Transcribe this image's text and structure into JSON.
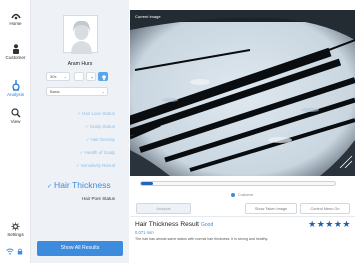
{
  "nav": {
    "items": [
      {
        "label": "Home",
        "icon": "home-icon"
      },
      {
        "label": "Customer",
        "icon": "person-icon"
      },
      {
        "label": "Analysis",
        "icon": "analysis-icon",
        "active": true
      },
      {
        "label": "View",
        "icon": "search-icon"
      }
    ],
    "settings_label": "Settings"
  },
  "profile": {
    "name": "Aram Hurs",
    "zoom_select": "30x",
    "mode_select": "Basic"
  },
  "checklist": [
    {
      "label": "Hair Loss Status"
    },
    {
      "label": "Scalp Status"
    },
    {
      "label": "Hair Density"
    },
    {
      "label": "Health of Scalp"
    },
    {
      "label": "Sensitivity Result"
    }
  ],
  "selected_item": "Hair Thickness",
  "sub_item": "Hair Pore Status",
  "show_all_label": "Show All Results",
  "image": {
    "label": "Current Image"
  },
  "slider": {
    "progress": 0.06
  },
  "radio_label": "Customer",
  "buttons": {
    "analysis": "Analysis",
    "show_taken": "Show Taken Image",
    "control_menu": "Control Menu On"
  },
  "result": {
    "title": "Hair Thickness Result",
    "status": "Good",
    "value": "0.071 mm",
    "description": "The hair has almost same status with normal hair thickness. It is strong and healthy.",
    "stars": 5
  },
  "colors": {
    "accent": "#3d8bdc",
    "star": "#1f5fa8",
    "panel": "#eef2f6"
  }
}
